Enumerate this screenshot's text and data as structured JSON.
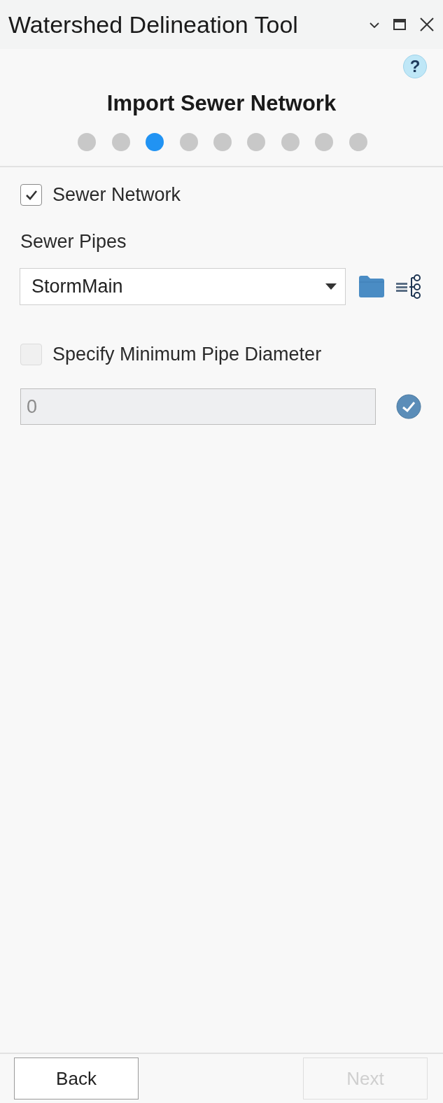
{
  "window": {
    "title": "Watershed Delineation Tool"
  },
  "help_button": {
    "label": "?"
  },
  "heading": "Import Sewer Network",
  "steps": [
    {
      "selected": false
    },
    {
      "selected": false
    },
    {
      "selected": true
    },
    {
      "selected": false
    },
    {
      "selected": false
    },
    {
      "selected": false
    },
    {
      "selected": false
    },
    {
      "selected": false
    },
    {
      "selected": false
    }
  ],
  "sewer_network": {
    "label": "Sewer Network",
    "checked": true
  },
  "sewer_pipes": {
    "label": "Sewer Pipes",
    "value": "StormMain"
  },
  "min_diameter": {
    "label": "Specify Minimum Pipe Diameter",
    "checked": false,
    "disabled": true,
    "value": "0"
  },
  "buttons": [
    {
      "label": "Back",
      "disabled": false
    },
    {
      "label": "Next",
      "disabled": true
    }
  ]
}
